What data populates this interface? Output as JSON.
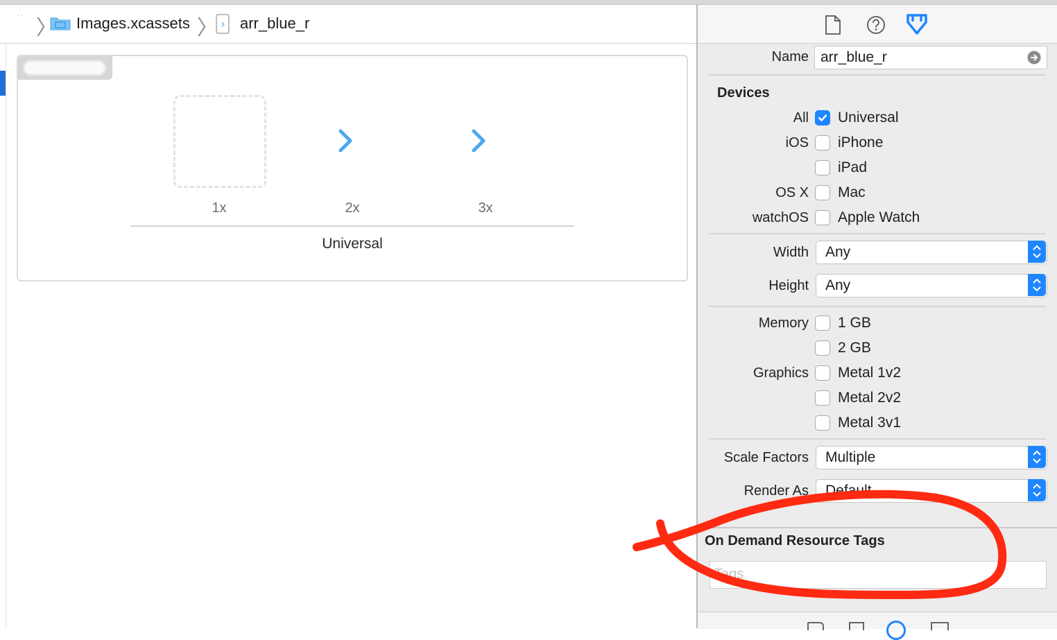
{
  "breadcrumb": {
    "folder": "Images.xcassets",
    "file": "arr_blue_r"
  },
  "asset_set": {
    "slots": [
      {
        "label": "1x",
        "state": "empty"
      },
      {
        "label": "2x",
        "state": "filled"
      },
      {
        "label": "3x",
        "state": "filled"
      }
    ],
    "idiom_label": "Universal"
  },
  "inspector": {
    "tabs": [
      {
        "icon": "file-icon"
      },
      {
        "icon": "help-icon"
      },
      {
        "icon": "attributes-icon",
        "selected": true
      }
    ],
    "name": {
      "label": "Name",
      "value": "arr_blue_r"
    },
    "devices": {
      "title": "Devices",
      "rows": [
        {
          "group": "All",
          "label": "Universal",
          "checked": true
        },
        {
          "group": "iOS",
          "label": "iPhone",
          "checked": false
        },
        {
          "group": "",
          "label": "iPad",
          "checked": false
        },
        {
          "group": "OS X",
          "label": "Mac",
          "checked": false
        },
        {
          "group": "watchOS",
          "label": "Apple Watch",
          "checked": false
        }
      ]
    },
    "size_classes": {
      "width": {
        "label": "Width",
        "value": "Any"
      },
      "height": {
        "label": "Height",
        "value": "Any"
      }
    },
    "hardware": {
      "rows": [
        {
          "group": "Memory",
          "label": "1 GB",
          "checked": false
        },
        {
          "group": "",
          "label": "2 GB",
          "checked": false
        },
        {
          "group": "Graphics",
          "label": "Metal 1v2",
          "checked": false
        },
        {
          "group": "",
          "label": "Metal 2v2",
          "checked": false
        },
        {
          "group": "",
          "label": "Metal 3v1",
          "checked": false
        }
      ]
    },
    "scale_factors": {
      "label": "Scale Factors",
      "value": "Multiple"
    },
    "render_as": {
      "label": "Render As",
      "value": "Default"
    },
    "on_demand": {
      "title": "On Demand Resource Tags",
      "placeholder": "Tags"
    }
  },
  "colors": {
    "accent": "#1f86ff",
    "arrow": "#4aa8f0",
    "annotation": "#ff2a12"
  }
}
